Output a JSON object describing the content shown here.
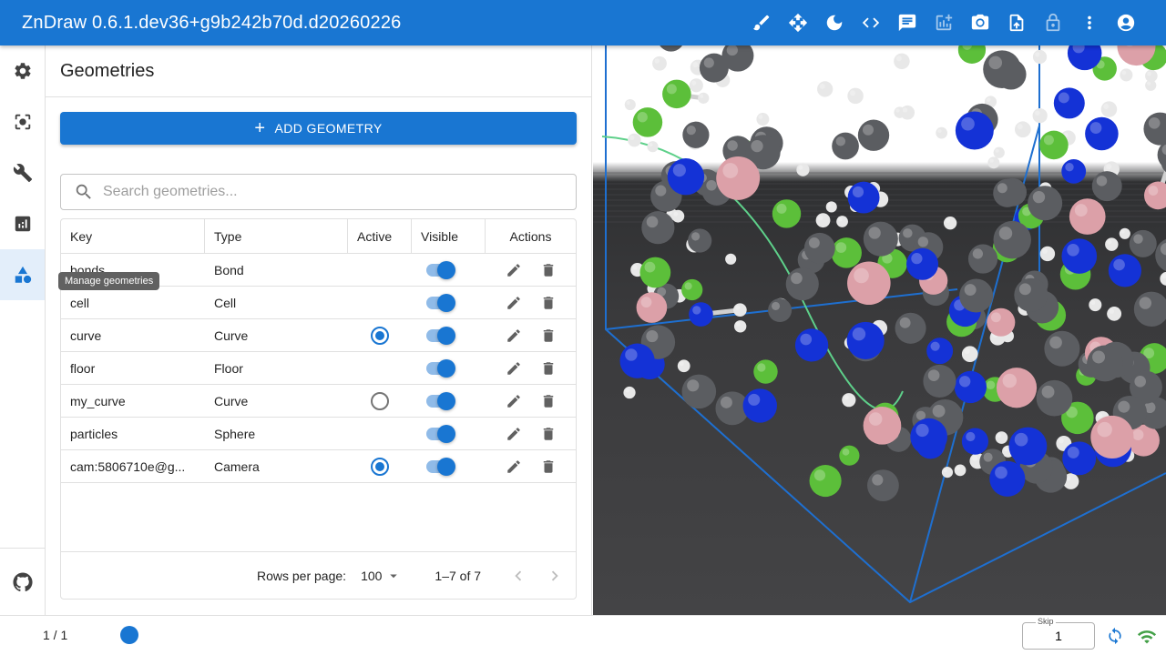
{
  "app": {
    "title": "ZnDraw 0.6.1.dev36+g9b242b70d.d20260226"
  },
  "toolbar": {
    "icons": [
      "brush-icon",
      "move-icon",
      "dark-mode-icon",
      "code-icon",
      "chat-icon",
      "add-chart-icon",
      "camera-icon",
      "upload-icon",
      "lock-icon",
      "more-vert-icon",
      "account-icon"
    ]
  },
  "rail": {
    "items": [
      "settings-icon",
      "selection-icon",
      "wrench-icon",
      "analytics-icon",
      "geometry-icon",
      "github-icon"
    ],
    "tooltip": "Manage geometries"
  },
  "panel": {
    "title": "Geometries",
    "add_label": "ADD GEOMETRY",
    "search_placeholder": "Search geometries..."
  },
  "table": {
    "headers": {
      "key": "Key",
      "type": "Type",
      "active": "Active",
      "visible": "Visible",
      "actions": "Actions"
    },
    "rows": [
      {
        "key": "bonds",
        "type": "Bond",
        "active": null,
        "visible": true
      },
      {
        "key": "cell",
        "type": "Cell",
        "active": null,
        "visible": true
      },
      {
        "key": "curve",
        "type": "Curve",
        "active": true,
        "visible": true
      },
      {
        "key": "floor",
        "type": "Floor",
        "active": null,
        "visible": true
      },
      {
        "key": "my_curve",
        "type": "Curve",
        "active": false,
        "visible": true
      },
      {
        "key": "particles",
        "type": "Sphere",
        "active": null,
        "visible": true
      },
      {
        "key": "cam:5806710e@g...",
        "type": "Camera",
        "active": true,
        "visible": true
      }
    ],
    "footer": {
      "rows_per_page_label": "Rows per page:",
      "rows_per_page": "100",
      "range": "1–7 of 7"
    }
  },
  "colors": {
    "primary": "#1976d2",
    "carbon": "#5b5d61",
    "hydrogen": "#e8e8e8",
    "nitrogen": "#1432d6",
    "chlorine": "#5cbf3a",
    "boron": "#dca0a8",
    "cell": "#1e6fd0"
  },
  "bottom": {
    "frame": "1 / 1",
    "skip_label": "Skip",
    "skip_value": "1"
  }
}
